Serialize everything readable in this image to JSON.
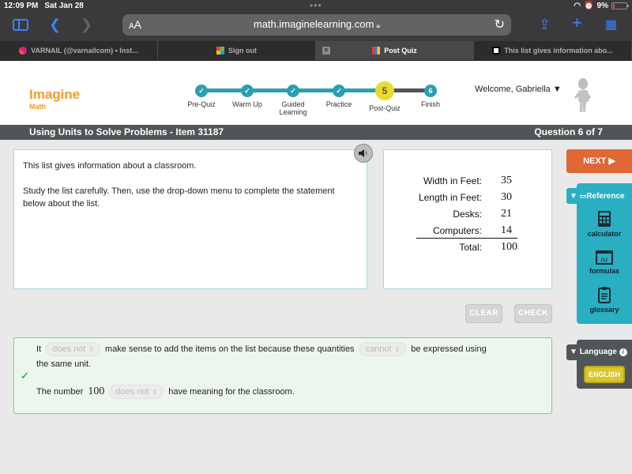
{
  "status_bar": {
    "time": "12:09 PM",
    "date": "Sat Jan 28",
    "battery": "9%",
    "dots": "•••"
  },
  "browser": {
    "url": "math.imaginelearning.com",
    "aa_label": "AA",
    "tabs": [
      {
        "title": "VARNAIL (@varnailcom) • Inst...",
        "favicon": "instagram-icon",
        "active": false
      },
      {
        "title": "Sign out",
        "favicon": "microsoft-icon",
        "active": false
      },
      {
        "title": "Post Quiz",
        "favicon": "imagine-learning-icon",
        "active": true
      },
      {
        "title": "This list gives information abo...",
        "favicon": "document-icon",
        "active": false
      }
    ]
  },
  "header": {
    "logo_main": "Imagine",
    "logo_sub": "Math",
    "welcome": "Welcome, Gabriella ▼",
    "steps": [
      {
        "label": "Pre-Quiz",
        "state": "done"
      },
      {
        "label": "Warm Up",
        "state": "done"
      },
      {
        "label": "Guided Learning",
        "state": "done"
      },
      {
        "label": "Practice",
        "state": "done"
      },
      {
        "label": "Post-Quiz",
        "state": "current",
        "number": "5"
      },
      {
        "label": "Finish",
        "state": "upcoming",
        "number": "6"
      }
    ]
  },
  "titlebar": {
    "lesson": "Using Units to Solve Problems - Item 31187",
    "question": "Question 6 of 7"
  },
  "prompt": {
    "line1": "This list gives information about a classroom.",
    "line2": "Study the list carefully. Then, use the drop-down menu to complete the statement below about the list."
  },
  "list": {
    "rows": [
      {
        "label": "Width in Feet:",
        "value": "35"
      },
      {
        "label": "Length in Feet:",
        "value": "30"
      },
      {
        "label": "Desks:",
        "value": "21"
      },
      {
        "label": "Computers:",
        "value": "14"
      }
    ],
    "total_label": "Total:",
    "total_value": "100"
  },
  "buttons": {
    "clear": "CLEAR",
    "check": "CHECK",
    "next": "NEXT ▶"
  },
  "answer": {
    "s1_before": "It",
    "s1_dropdown1": "does not",
    "s1_middle": "make sense to add the items on the list because these quantities",
    "s1_dropdown2": "cannot",
    "s1_after": "be expressed using",
    "s1_cont": "the same unit.",
    "s2_before": "The number",
    "s2_number": "100",
    "s2_dropdown": "does not",
    "s2_after": "have meaning for the classroom.",
    "status": "correct"
  },
  "reference": {
    "title": "Reference",
    "items": [
      "calculator",
      "formulas",
      "glossary"
    ]
  },
  "language": {
    "title": "Language",
    "current": "ENGLISH"
  },
  "colors": {
    "accent_teal": "#2aaec1",
    "next_orange": "#df6836",
    "current_step_yellow": "#eadb2b",
    "logo_orange": "#f29a2e",
    "correct_green": "#4caf50"
  }
}
